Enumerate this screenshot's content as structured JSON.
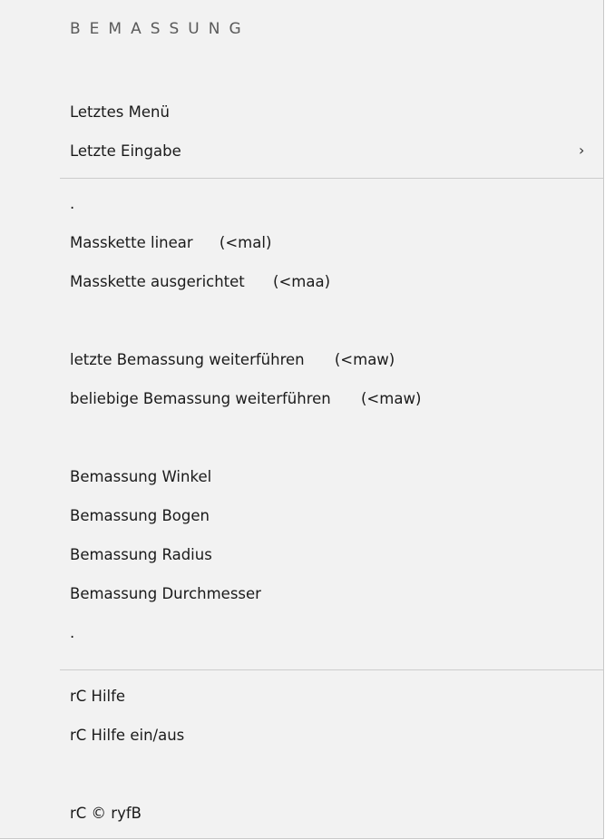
{
  "menu": {
    "header": "BEMASSUNG",
    "items": [
      {
        "label": "Letztes Menü"
      },
      {
        "label": "Letzte Eingabe",
        "submenu_icon": "chevron-right-icon"
      },
      {
        "label": "."
      },
      {
        "label": "Masskette linear",
        "shortcut": "(<mal)"
      },
      {
        "label": "Masskette ausgerichtet",
        "shortcut": "(<maa)"
      },
      {
        "label": "letzte Bemassung weiterführen",
        "shortcut": "(<maw)"
      },
      {
        "label": "beliebige Bemassung weiterführen",
        "shortcut": "(<maw)"
      },
      {
        "label": "Bemassung Winkel"
      },
      {
        "label": "Bemassung Bogen"
      },
      {
        "label": "Bemassung Radius"
      },
      {
        "label": "Bemassung Durchmesser"
      },
      {
        "label": "."
      },
      {
        "label": "rC Hilfe"
      },
      {
        "label": "rC Hilfe ein/aus"
      },
      {
        "label": "rC © ryfB"
      }
    ],
    "chevron": "›"
  },
  "colors": {
    "menu_background": "#f2f2f2",
    "text": "#1a1a1a",
    "header_text": "#5a5a5a",
    "separator": "#cccccc"
  }
}
